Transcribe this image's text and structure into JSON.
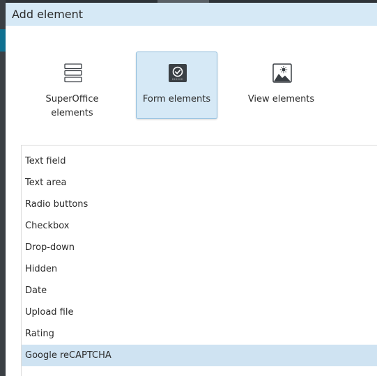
{
  "dialog": {
    "title": "Add element"
  },
  "categories": [
    {
      "label_line1": "SuperOffice",
      "label_line2": "elements",
      "icon": "stacked-list-icon",
      "selected": false
    },
    {
      "label_line1": "Form elements",
      "label_line2": "",
      "icon": "form-check-icon",
      "selected": true
    },
    {
      "label_line1": "View elements",
      "label_line2": "",
      "icon": "image-icon",
      "selected": false
    }
  ],
  "elements": [
    {
      "label": "Text field",
      "selected": false
    },
    {
      "label": "Text area",
      "selected": false
    },
    {
      "label": "Radio buttons",
      "selected": false
    },
    {
      "label": "Checkbox",
      "selected": false
    },
    {
      "label": "Drop-down",
      "selected": false
    },
    {
      "label": "Hidden",
      "selected": false
    },
    {
      "label": "Date",
      "selected": false
    },
    {
      "label": "Upload file",
      "selected": false
    },
    {
      "label": "Rating",
      "selected": false
    },
    {
      "label": "Google reCAPTCHA",
      "selected": true
    }
  ],
  "colors": {
    "header_bg": "#d6e9f6",
    "selection_bg": "#cfe3f2",
    "icon_dark": "#3a3f44"
  }
}
